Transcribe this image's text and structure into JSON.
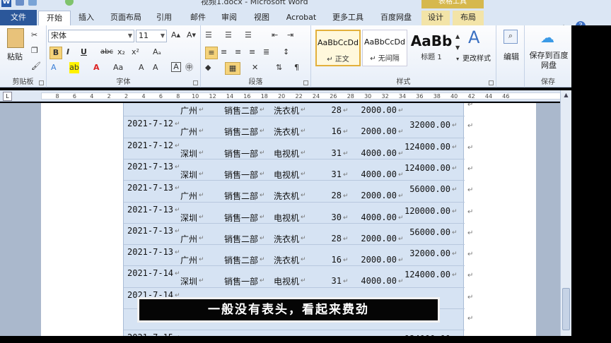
{
  "titlebar": {
    "app_logo": "W",
    "doc_title": "视频1.docx - Microsoft Word",
    "table_tools": "表格工具"
  },
  "tabs": {
    "file": "文件",
    "home": "开始",
    "insert": "插入",
    "page_layout": "页面布局",
    "references": "引用",
    "mailings": "邮件",
    "review": "审阅",
    "view": "视图",
    "acrobat": "Acrobat",
    "more_tools": "更多工具",
    "baidu_netdisk": "百度网盘",
    "design": "设计",
    "layout": "布局"
  },
  "ribbon": {
    "clipboard": {
      "paste": "粘贴",
      "label": "剪贴板"
    },
    "font": {
      "name": "宋体",
      "size": "11",
      "label": "字体",
      "bold": "B",
      "italic": "I",
      "underline": "U",
      "strike": "abc",
      "subscript": "x₂",
      "superscript": "x²"
    },
    "paragraph": {
      "label": "段落"
    },
    "styles": {
      "label": "样式",
      "items": [
        {
          "preview": "AaBbCcDd",
          "name": "↵ 正文"
        },
        {
          "preview": "AaBbCcDd",
          "name": "↵ 无间隔"
        },
        {
          "preview": "AaBb",
          "name": "标题 1"
        }
      ],
      "change_styles": "更改样式"
    },
    "editing": {
      "label": "编辑"
    },
    "save": {
      "save_to_baidu": "保存到百度网盘",
      "label": "保存"
    }
  },
  "ruler": {
    "numbers": [
      "8",
      "6",
      "4",
      "2",
      "2",
      "4",
      "6",
      "8",
      "10",
      "12",
      "14",
      "16",
      "18",
      "20",
      "22",
      "24",
      "26",
      "28",
      "30",
      "32",
      "34",
      "36",
      "38",
      "40",
      "42",
      "44",
      "46"
    ]
  },
  "table": {
    "rows": [
      {
        "date": "",
        "city": "广州",
        "dept": "销售二部",
        "product": "洗衣机",
        "qty": "28",
        "price": "2000.00",
        "total": ""
      },
      {
        "date": "2021-7-12",
        "city": "广州",
        "dept": "销售二部",
        "product": "洗衣机",
        "qty": "16",
        "price": "2000.00",
        "total": "32000.00"
      },
      {
        "date": "2021-7-12",
        "city": "深圳",
        "dept": "销售一部",
        "product": "电视机",
        "qty": "31",
        "price": "4000.00",
        "total": "124000.00"
      },
      {
        "date": "2021-7-13",
        "city": "深圳",
        "dept": "销售一部",
        "product": "电视机",
        "qty": "31",
        "price": "4000.00",
        "total": "124000.00"
      },
      {
        "date": "2021-7-13",
        "city": "广州",
        "dept": "销售二部",
        "product": "洗衣机",
        "qty": "28",
        "price": "2000.00",
        "total": "56000.00"
      },
      {
        "date": "2021-7-13",
        "city": "深圳",
        "dept": "销售一部",
        "product": "电视机",
        "qty": "30",
        "price": "4000.00",
        "total": "120000.00"
      },
      {
        "date": "2021-7-13",
        "city": "广州",
        "dept": "销售二部",
        "product": "洗衣机",
        "qty": "28",
        "price": "2000.00",
        "total": "56000.00"
      },
      {
        "date": "2021-7-13",
        "city": "广州",
        "dept": "销售二部",
        "product": "洗衣机",
        "qty": "16",
        "price": "2000.00",
        "total": "32000.00"
      },
      {
        "date": "2021-7-14",
        "city": "深圳",
        "dept": "销售一部",
        "product": "电视机",
        "qty": "31",
        "price": "4000.00",
        "total": "124000.00"
      },
      {
        "date": "2021-7-14",
        "city": "",
        "dept": "",
        "product": "",
        "qty": "",
        "price": "",
        "total": ""
      },
      {
        "date": "",
        "city": "",
        "dept": "",
        "product": "",
        "qty": "",
        "price": "",
        "total": ""
      },
      {
        "date": "2021-7-15",
        "city": "",
        "dept": "",
        "product": "",
        "qty": "",
        "price": "",
        "total": "124000.00"
      }
    ]
  },
  "subtitle": "一般没有表头，看起来费劲"
}
